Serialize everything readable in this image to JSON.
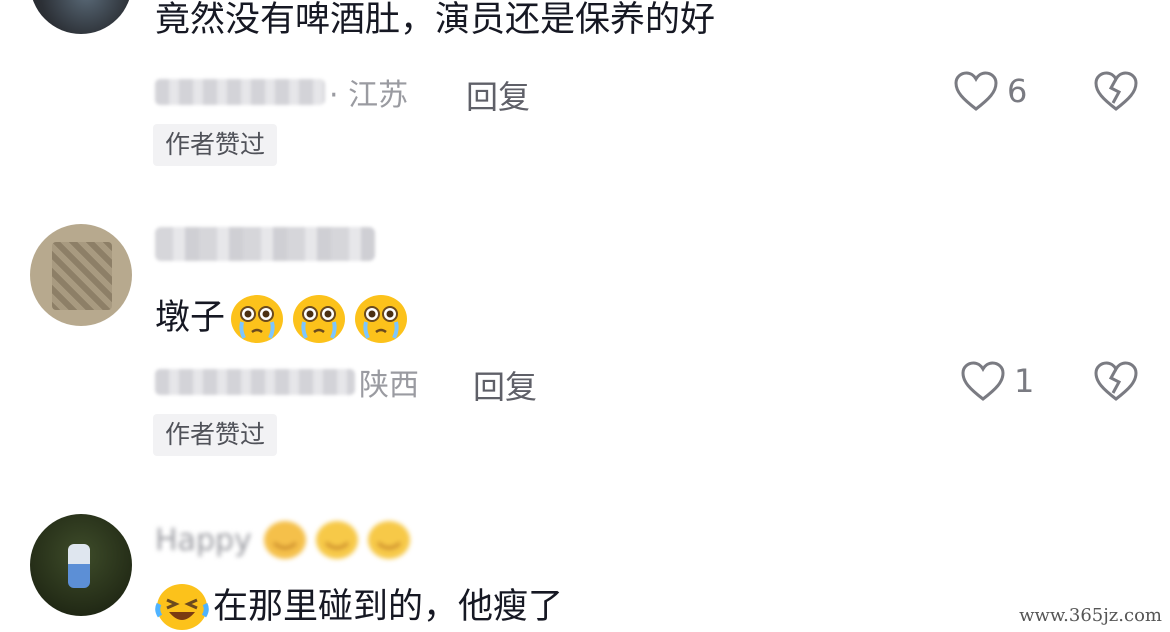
{
  "comments": [
    {
      "text": "竟然没有啤酒肚，演员还是保养的好",
      "location": "· 江苏",
      "reply_label": "回复",
      "likes": "6",
      "badge": "作者赞过"
    },
    {
      "text": "墩子",
      "location": "陕西",
      "reply_label": "回复",
      "likes": "1",
      "badge": "作者赞过"
    },
    {
      "text": "在那里碰到的，他瘦了",
      "username": "Happy"
    }
  ],
  "watermark": "www.365jz.com",
  "colors": {
    "text_primary": "#161823",
    "text_secondary": "#9a9ba1",
    "badge_bg": "#f2f2f4",
    "emoji_yellow": "#fcc21b"
  },
  "icons": [
    "heart-outline-icon",
    "broken-heart-icon",
    "crying-emoji-icon",
    "laughing-tears-emoji-icon"
  ]
}
